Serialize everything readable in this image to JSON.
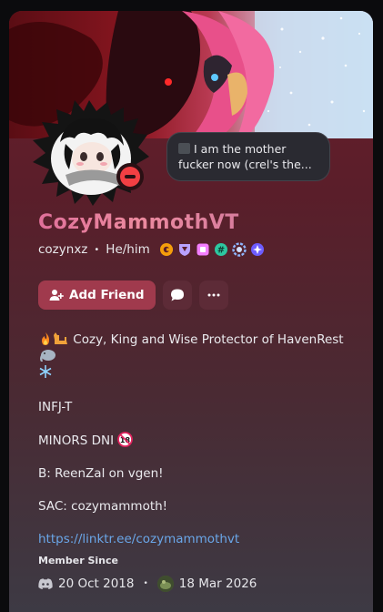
{
  "status": {
    "text": "I am the mother fucker now (crel's the..."
  },
  "profile": {
    "display_name": "CozyMammothVT",
    "username": "cozynxz",
    "pronouns": "He/him",
    "badges": [
      "hypesquad-balance-icon",
      "nitro-icon",
      "boost-icon",
      "quest-icon",
      "active-developer-icon",
      "orbs-icon"
    ]
  },
  "actions": {
    "add_friend": "Add Friend"
  },
  "bio": {
    "line1": "Cozy, King and Wise Protector of HavenRest",
    "line2": "INFJ-T",
    "line3": "MINORS DNI",
    "line4": "B: ReenZal on vgen!",
    "line5": "SAC: cozymammoth!",
    "link": "https://linktr.ee/cozymammothvt"
  },
  "member_since": {
    "title": "Member Since",
    "discord_date": "20 Oct 2018",
    "server_date": "18 Mar 2026"
  },
  "colors": {
    "accent": "#a03a4d",
    "card_top": "#6b1f2c",
    "card_bottom": "#3d3a44",
    "link": "#6aa6e8",
    "status_dnd": "#f23f43"
  }
}
